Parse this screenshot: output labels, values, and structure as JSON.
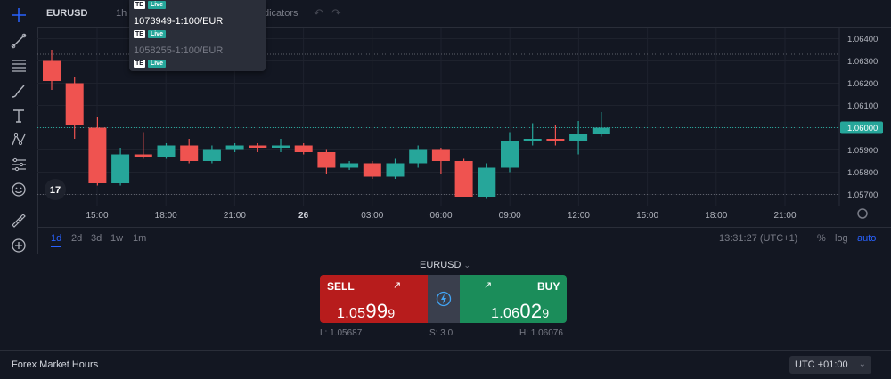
{
  "topbar": {
    "symbol": "EURUSD",
    "interval": "1h",
    "indicators": "dicators",
    "undo_icon": "undo-icon",
    "redo_icon": "redo-icon"
  },
  "accounts_dropdown": {
    "items": [
      {
        "label": "",
        "tag_te": "TE",
        "tag_live": "Live"
      },
      {
        "label": "1073949-1:100/EUR",
        "tag_te": "TE",
        "tag_live": "Live"
      },
      {
        "label": "1058255-1:100/EUR",
        "tag_te": "TE",
        "tag_live": "Live"
      }
    ]
  },
  "chart": {
    "price_labels": [
      "1.06400",
      "1.06300",
      "1.06200",
      "1.06100",
      "1.06000",
      "1.05900",
      "1.05800",
      "1.05700"
    ],
    "current_price_label": "1.06000",
    "time_labels": [
      "15:00",
      "18:00",
      "21:00",
      "26",
      "03:00",
      "06:00",
      "09:00",
      "12:00",
      "15:00",
      "18:00",
      "21:00"
    ],
    "logo": "17",
    "colors": {
      "up": "#26a69a",
      "down": "#ef5350",
      "background": "#131722",
      "grid": "#1e222d"
    }
  },
  "chart_data": {
    "type": "candlestick",
    "ylim": [
      1.0565,
      1.0645
    ],
    "x": [
      "13:00",
      "14:00",
      "15:00",
      "16:00",
      "17:00",
      "18:00",
      "19:00",
      "20:00",
      "21:00",
      "22:00",
      "23:00",
      "00:00",
      "01:00",
      "02:00",
      "03:00",
      "04:00",
      "05:00",
      "06:00",
      "07:00",
      "08:00",
      "09:00",
      "10:00",
      "11:00",
      "12:00",
      "13:00"
    ],
    "candles": [
      {
        "o": 1.063,
        "h": 1.0635,
        "l": 1.0617,
        "c": 1.0621
      },
      {
        "o": 1.062,
        "h": 1.0623,
        "l": 1.0595,
        "c": 1.0601
      },
      {
        "o": 1.06,
        "h": 1.0605,
        "l": 1.0574,
        "c": 1.0575
      },
      {
        "o": 1.0575,
        "h": 1.0591,
        "l": 1.0574,
        "c": 1.0588
      },
      {
        "o": 1.0588,
        "h": 1.0598,
        "l": 1.0586,
        "c": 1.0587
      },
      {
        "o": 1.0587,
        "h": 1.0593,
        "l": 1.0586,
        "c": 1.0592
      },
      {
        "o": 1.0592,
        "h": 1.0595,
        "l": 1.0584,
        "c": 1.0585
      },
      {
        "o": 1.0585,
        "h": 1.0592,
        "l": 1.0584,
        "c": 1.059
      },
      {
        "o": 1.059,
        "h": 1.0593,
        "l": 1.0589,
        "c": 1.0592
      },
      {
        "o": 1.0592,
        "h": 1.0593,
        "l": 1.0589,
        "c": 1.0591
      },
      {
        "o": 1.0591,
        "h": 1.0595,
        "l": 1.0589,
        "c": 1.0592
      },
      {
        "o": 1.0592,
        "h": 1.0593,
        "l": 1.0588,
        "c": 1.0589
      },
      {
        "o": 1.0589,
        "h": 1.059,
        "l": 1.0579,
        "c": 1.0582
      },
      {
        "o": 1.0582,
        "h": 1.0585,
        "l": 1.0581,
        "c": 1.0584
      },
      {
        "o": 1.0584,
        "h": 1.0585,
        "l": 1.0577,
        "c": 1.0578
      },
      {
        "o": 1.0578,
        "h": 1.0586,
        "l": 1.0577,
        "c": 1.0584
      },
      {
        "o": 1.0584,
        "h": 1.0592,
        "l": 1.0582,
        "c": 1.059
      },
      {
        "o": 1.059,
        "h": 1.0591,
        "l": 1.0579,
        "c": 1.0585
      },
      {
        "o": 1.0585,
        "h": 1.0586,
        "l": 1.0569,
        "c": 1.0569
      },
      {
        "o": 1.0569,
        "h": 1.0584,
        "l": 1.0568,
        "c": 1.0582
      },
      {
        "o": 1.0582,
        "h": 1.0598,
        "l": 1.058,
        "c": 1.0594
      },
      {
        "o": 1.0594,
        "h": 1.0602,
        "l": 1.0592,
        "c": 1.0595
      },
      {
        "o": 1.0595,
        "h": 1.0601,
        "l": 1.0592,
        "c": 1.0594
      },
      {
        "o": 1.0594,
        "h": 1.0603,
        "l": 1.0588,
        "c": 1.0597
      },
      {
        "o": 1.0597,
        "h": 1.0607,
        "l": 1.0596,
        "c": 1.06
      }
    ],
    "reference_lines": [
      1.0633,
      1.06,
      1.057
    ]
  },
  "bottombar": {
    "ranges": [
      "1d",
      "2d",
      "3d",
      "1w",
      "1m"
    ],
    "clock": "13:31:27 (UTC+1)",
    "percent": "%",
    "log": "log",
    "auto": "auto"
  },
  "trade": {
    "pair": "EURUSD",
    "sell_label": "SELL",
    "buy_label": "BUY",
    "sell_price": {
      "pre": "1.05",
      "big": "99",
      "post": "9"
    },
    "buy_price": {
      "pre": "1.06",
      "big": "02",
      "post": "9"
    },
    "low": "L: 1.05687",
    "spread": "S: 3.0",
    "high": "H: 1.06076",
    "colors": {
      "sell": "#b71c1c",
      "buy": "#1b8d5a"
    }
  },
  "footer": {
    "title": "Forex Market Hours",
    "timezone": "UTC +01:00"
  }
}
